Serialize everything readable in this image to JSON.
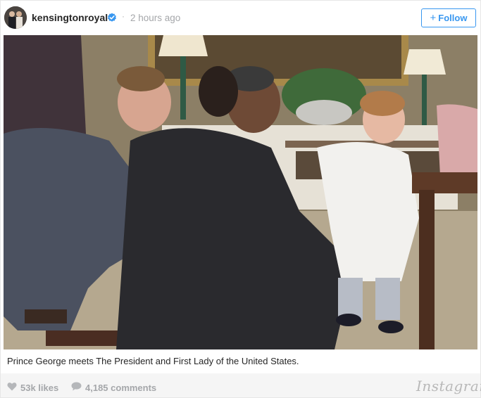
{
  "header": {
    "username": "kensingtonroyal",
    "separator": "·",
    "timestamp": "2 hours ago",
    "follow_label": "Follow",
    "follow_plus": "+"
  },
  "post": {
    "caption": "Prince George meets The President and First Lady of the United States."
  },
  "footer": {
    "likes": "53k likes",
    "comments": "4,185 comments",
    "brand": "Instagram"
  },
  "colors": {
    "accent": "#3897f0",
    "muted": "#a5a7aa",
    "footer_bg": "#f5f5f5"
  },
  "icons": {
    "verified": "verified-badge-icon",
    "heart": "heart-icon",
    "comment": "comment-bubble-icon"
  }
}
